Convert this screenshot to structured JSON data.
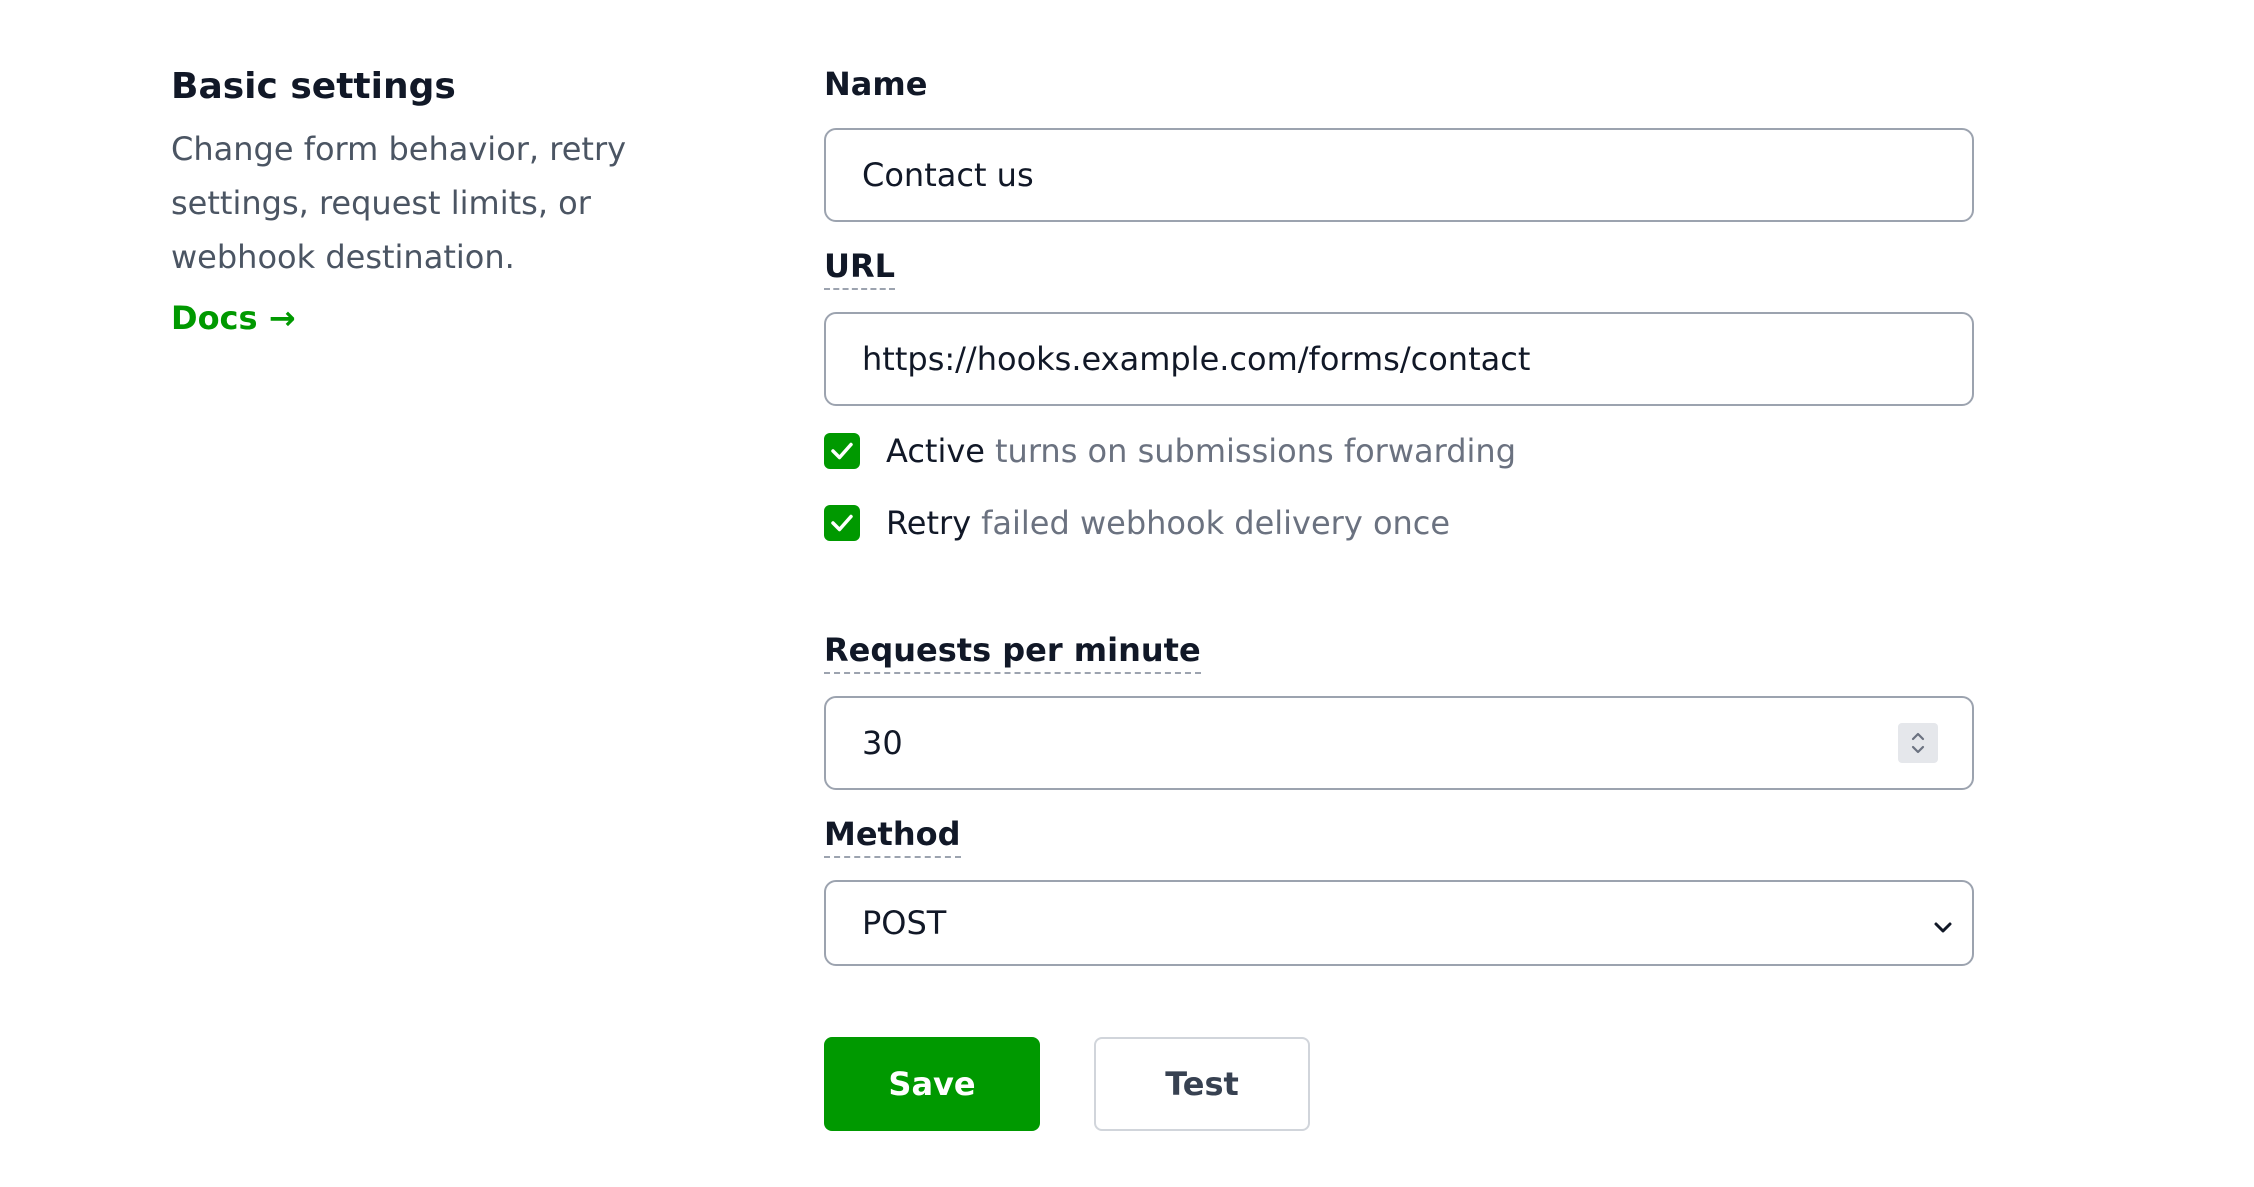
{
  "section": {
    "title": "Basic settings",
    "description": "Change form behavior, retry settings, request limits, or webhook destination.",
    "docs_link": "Docs →"
  },
  "fields": {
    "name": {
      "label": "Name",
      "value": "Contact us"
    },
    "url": {
      "label": "URL",
      "value": "https://hooks.example.com/forms/contact"
    },
    "active": {
      "checked": true,
      "label": "Active",
      "hint": "turns on submissions forwarding"
    },
    "retry": {
      "checked": true,
      "label": "Retry",
      "hint": "failed webhook delivery once"
    },
    "requests_per_minute": {
      "label": "Requests per minute",
      "value": "30"
    },
    "method": {
      "label": "Method",
      "selected": "POST"
    }
  },
  "actions": {
    "save_label": "Save",
    "test_label": "Test"
  },
  "colors": {
    "accent": "#009900",
    "text": "#111827",
    "muted": "#6b7280",
    "border": "#9ca3af"
  },
  "icons": {
    "checkbox": "check-icon",
    "stepper": "stepper-arrows-icon",
    "select": "chevron-down-icon"
  }
}
